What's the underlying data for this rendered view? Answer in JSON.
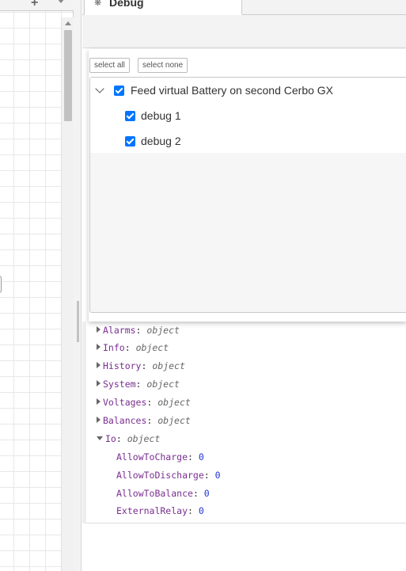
{
  "workspace": {
    "add_icon": "plus-icon",
    "menu_icon": "caret-down-icon"
  },
  "sidebar": {
    "tab": {
      "label": "Debug",
      "icon": "bug-icon"
    },
    "filter": {
      "select_all_label": "select all",
      "select_none_label": "select none",
      "tree": [
        {
          "label": "Feed virtual Battery on second Cerbo GX",
          "checked": true,
          "expanded": true
        },
        {
          "label": "debug 1",
          "checked": true
        },
        {
          "label": "debug 2",
          "checked": true
        }
      ]
    },
    "messages": [
      {
        "key": "Alarms",
        "type": "object",
        "expanded": false
      },
      {
        "key": "Info",
        "type": "object",
        "expanded": false
      },
      {
        "key": "History",
        "type": "object",
        "expanded": false
      },
      {
        "key": "System",
        "type": "object",
        "expanded": false
      },
      {
        "key": "Voltages",
        "type": "object",
        "expanded": false
      },
      {
        "key": "Balances",
        "type": "object",
        "expanded": false
      },
      {
        "key": "Io",
        "type": "object",
        "expanded": true
      },
      {
        "key": "AllowToCharge",
        "value": "0"
      },
      {
        "key": "AllowToDischarge",
        "value": "0"
      },
      {
        "key": "AllowToBalance",
        "value": "0"
      },
      {
        "key": "ExternalRelay",
        "value": "0"
      }
    ]
  },
  "colors": {
    "checkbox": "#0075ff",
    "key": "#792e90",
    "number": "#2033d6"
  }
}
